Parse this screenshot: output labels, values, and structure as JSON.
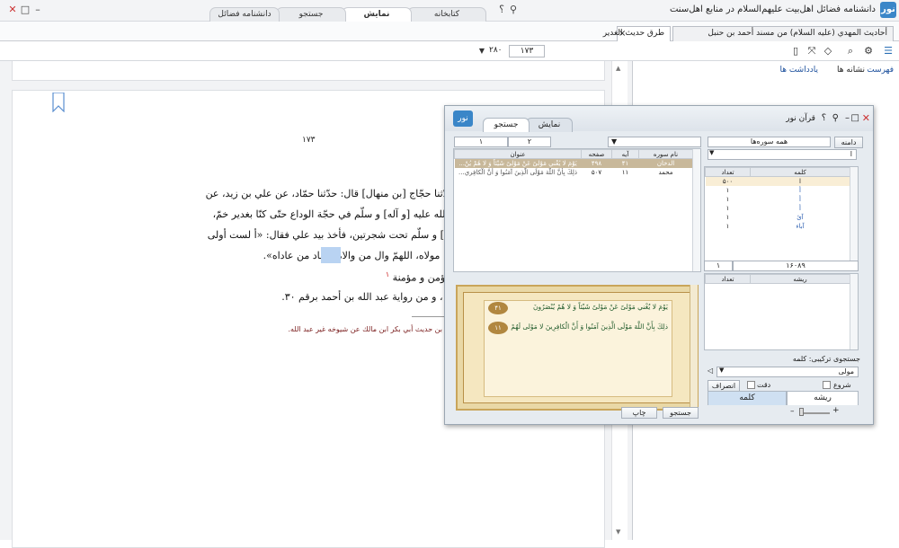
{
  "app": {
    "title": "دانشنامه فضائل اهل‌بیت علیهم‌السلام در منابع اهل‌سنت",
    "logo": "نور",
    "tabs": [
      "کتابخانه",
      "نمایش",
      "جستجو",
      "دانشنامه فضائل"
    ],
    "active_tab": "نمایش"
  },
  "doc_tabs": {
    "tab1": "أحاديث المهدي (عليه السلام) من مسند أحمد بن حنبل",
    "tab2": "طرق حديث الغدير",
    "close": "×"
  },
  "nav": {
    "current_page": "۱۷۳",
    "total_pages": "۲۸۰"
  },
  "right_panel": {
    "index": "فهرست",
    "bookmarks": "نشانه ها",
    "notes": "یادداشت ها"
  },
  "document": {
    "page_number": "۱۷۳",
    "lines": [
      "عي قال: حدّثنا إبراهيم [الحربي] قال: حدّثنا حجّاج [بن منهال] قال: حدّثنا حمّاد، عن علي بن زيد، عن",
      "و ابن عازب ـ قال: أقبلنا مع النبي صلّى الله عليه [و آله] و سلّم في حجّة الوداع حتّى كنّا بغدير خمّ،",
      "و كسح لرسول الله صلّى الله عليه [و آله] و سلّم تحت شجرتين، فأخذ بيد علي فقال: «أ لست أولى",
      "لى يا رسول الله. قال: «هذا مولى من أنا مولاه، اللهمّ وال من والاه و عاد من عاداه».",
      "أبي طالب أصبحت و أمسيت مولى كلّ مؤمن و مؤمنة",
      "قم ۱، و من رواية أحمد بن حنبل برقم ۱۱، و من رواية عبد الله بن أحمد برقم ۳۰."
    ],
    "highlight_word": "مولى",
    "footnote_ref": "۱",
    "footnote": "بن حديث أبي بكر ابن مالك عن شيوخه غير عبد الله."
  },
  "quran": {
    "title": "قرآن نور",
    "tabs": [
      "نمایش",
      "جستجو"
    ],
    "active_tab": "جستجو",
    "scope_button": "دامنه",
    "scope_value": "همه سوره‌ها",
    "page_field": "۲",
    "page_total": "۱",
    "word_field": "ا",
    "results_headers": [
      "نام سوره",
      "آیه",
      "صفحه",
      "عنوان"
    ],
    "results": [
      {
        "surah": "الدخان",
        "ayah": "۴۱",
        "page": "۴۹۸",
        "text": "يَوْمَ لا يُغْني مَوْلىً عَنْ مَوْلىً شَيْئاً وَ لا هُمْ يُنْ..."
      },
      {
        "surah": "محمد",
        "ayah": "۱۱",
        "page": "۵۰۷",
        "text": "ذلِكَ بِأَنَّ اللَّهَ مَوْلَى الَّذِينَ آمَنُوا وَ أَنَّ الْكافِري..."
      }
    ],
    "word_headers": [
      "کلمه",
      "تعداد"
    ],
    "words": [
      {
        "word": "ا",
        "count": "۵۰۰"
      },
      {
        "word": "أ",
        "count": "۱"
      },
      {
        "word": "أَ",
        "count": "۱"
      },
      {
        "word": "أ",
        "count": "۱"
      },
      {
        "word": "آئ",
        "count": "۱"
      },
      {
        "word": "آباء",
        "count": "۱"
      }
    ],
    "word_total": "۱۶۰۸۹",
    "word_total2": "۱",
    "root_headers": [
      "ریشه",
      "تعداد"
    ],
    "verse1": "يَوْمَ لا يُغْني مَوْلىً عَنْ مَوْلىً شَيْئاً وَ لا هُمْ يُنْصَرُونَ",
    "verse1_num": "۴۱",
    "verse2": "ذلِكَ بِأَنَّ اللَّهَ مَوْلَى الَّذِينَ آمَنُوا وَ أَنَّ الْكافِرِينَ لا مَوْلى‏ لَهُمْ",
    "verse2_num": "۱۱",
    "combo_label": "جستجوی ترکیبی: کلمه",
    "combo_value": "مولی",
    "opt_start": "شروع",
    "opt_exact": "دقت",
    "opt_inflect": "انصراف",
    "bottom_tabs": [
      "ریشه",
      "کلمه"
    ],
    "search_btn": "جستجو",
    "print_btn": "چاپ"
  }
}
